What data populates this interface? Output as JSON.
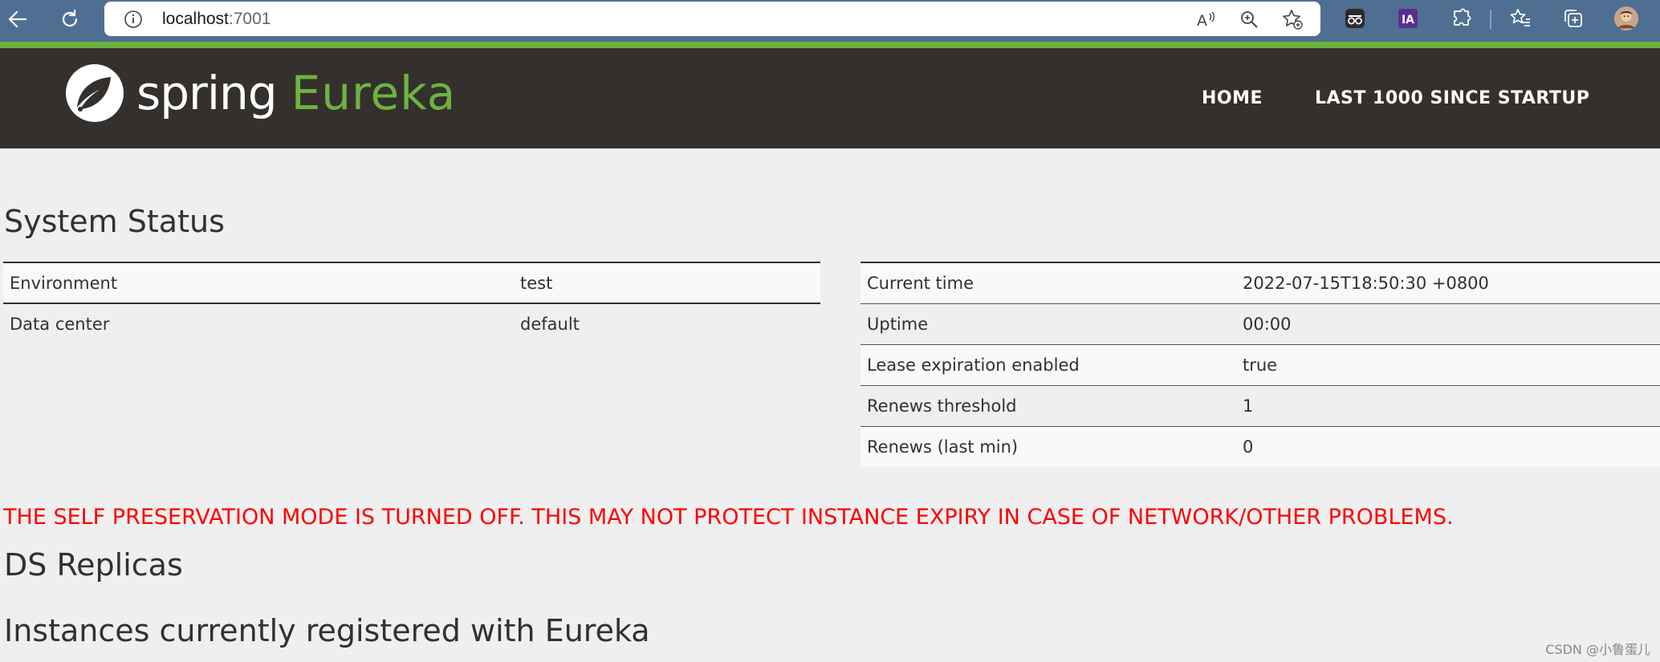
{
  "browser": {
    "address": {
      "host": "localhost",
      "port": ":7001"
    },
    "icons": {
      "back": "back-arrow-icon",
      "refresh": "refresh-icon",
      "info": "info-icon",
      "read_aloud": "read-aloud-icon",
      "zoom": "zoom-icon",
      "add_favorite": "add-favorite-icon",
      "extensions": [
        "incognito-extension-icon",
        "ia-extension-icon",
        "puzzle-extension-icon"
      ],
      "favorites": "favorites-icon",
      "collections": "collections-icon",
      "profile": "profile-avatar-icon"
    },
    "ext_ia_label": "IA"
  },
  "header": {
    "brand_spring": "spring",
    "brand_eureka": "Eureka",
    "nav": {
      "home": "HOME",
      "last1000": "LAST 1000 SINCE STARTUP"
    },
    "colors": {
      "bar": "#34302d",
      "accent": "#6db33f"
    }
  },
  "system_status": {
    "title": "System Status",
    "left_table": [
      {
        "label": "Environment",
        "value": "test"
      },
      {
        "label": "Data center",
        "value": "default"
      }
    ],
    "right_table": [
      {
        "label": "Current time",
        "value": "2022-07-15T18:50:30 +0800"
      },
      {
        "label": "Uptime",
        "value": "00:00"
      },
      {
        "label": "Lease expiration enabled",
        "value": "true"
      },
      {
        "label": "Renews threshold",
        "value": "1"
      },
      {
        "label": "Renews (last min)",
        "value": "0"
      }
    ]
  },
  "warning": {
    "text": "THE SELF PRESERVATION MODE IS TURNED OFF. THIS MAY NOT PROTECT INSTANCE EXPIRY IN CASE OF NETWORK/OTHER PROBLEMS.",
    "color": "#ff0000"
  },
  "sections": {
    "ds_replicas": "DS Replicas",
    "instances": "Instances currently registered with Eureka"
  },
  "watermark": "CSDN @小鲁蛋儿"
}
